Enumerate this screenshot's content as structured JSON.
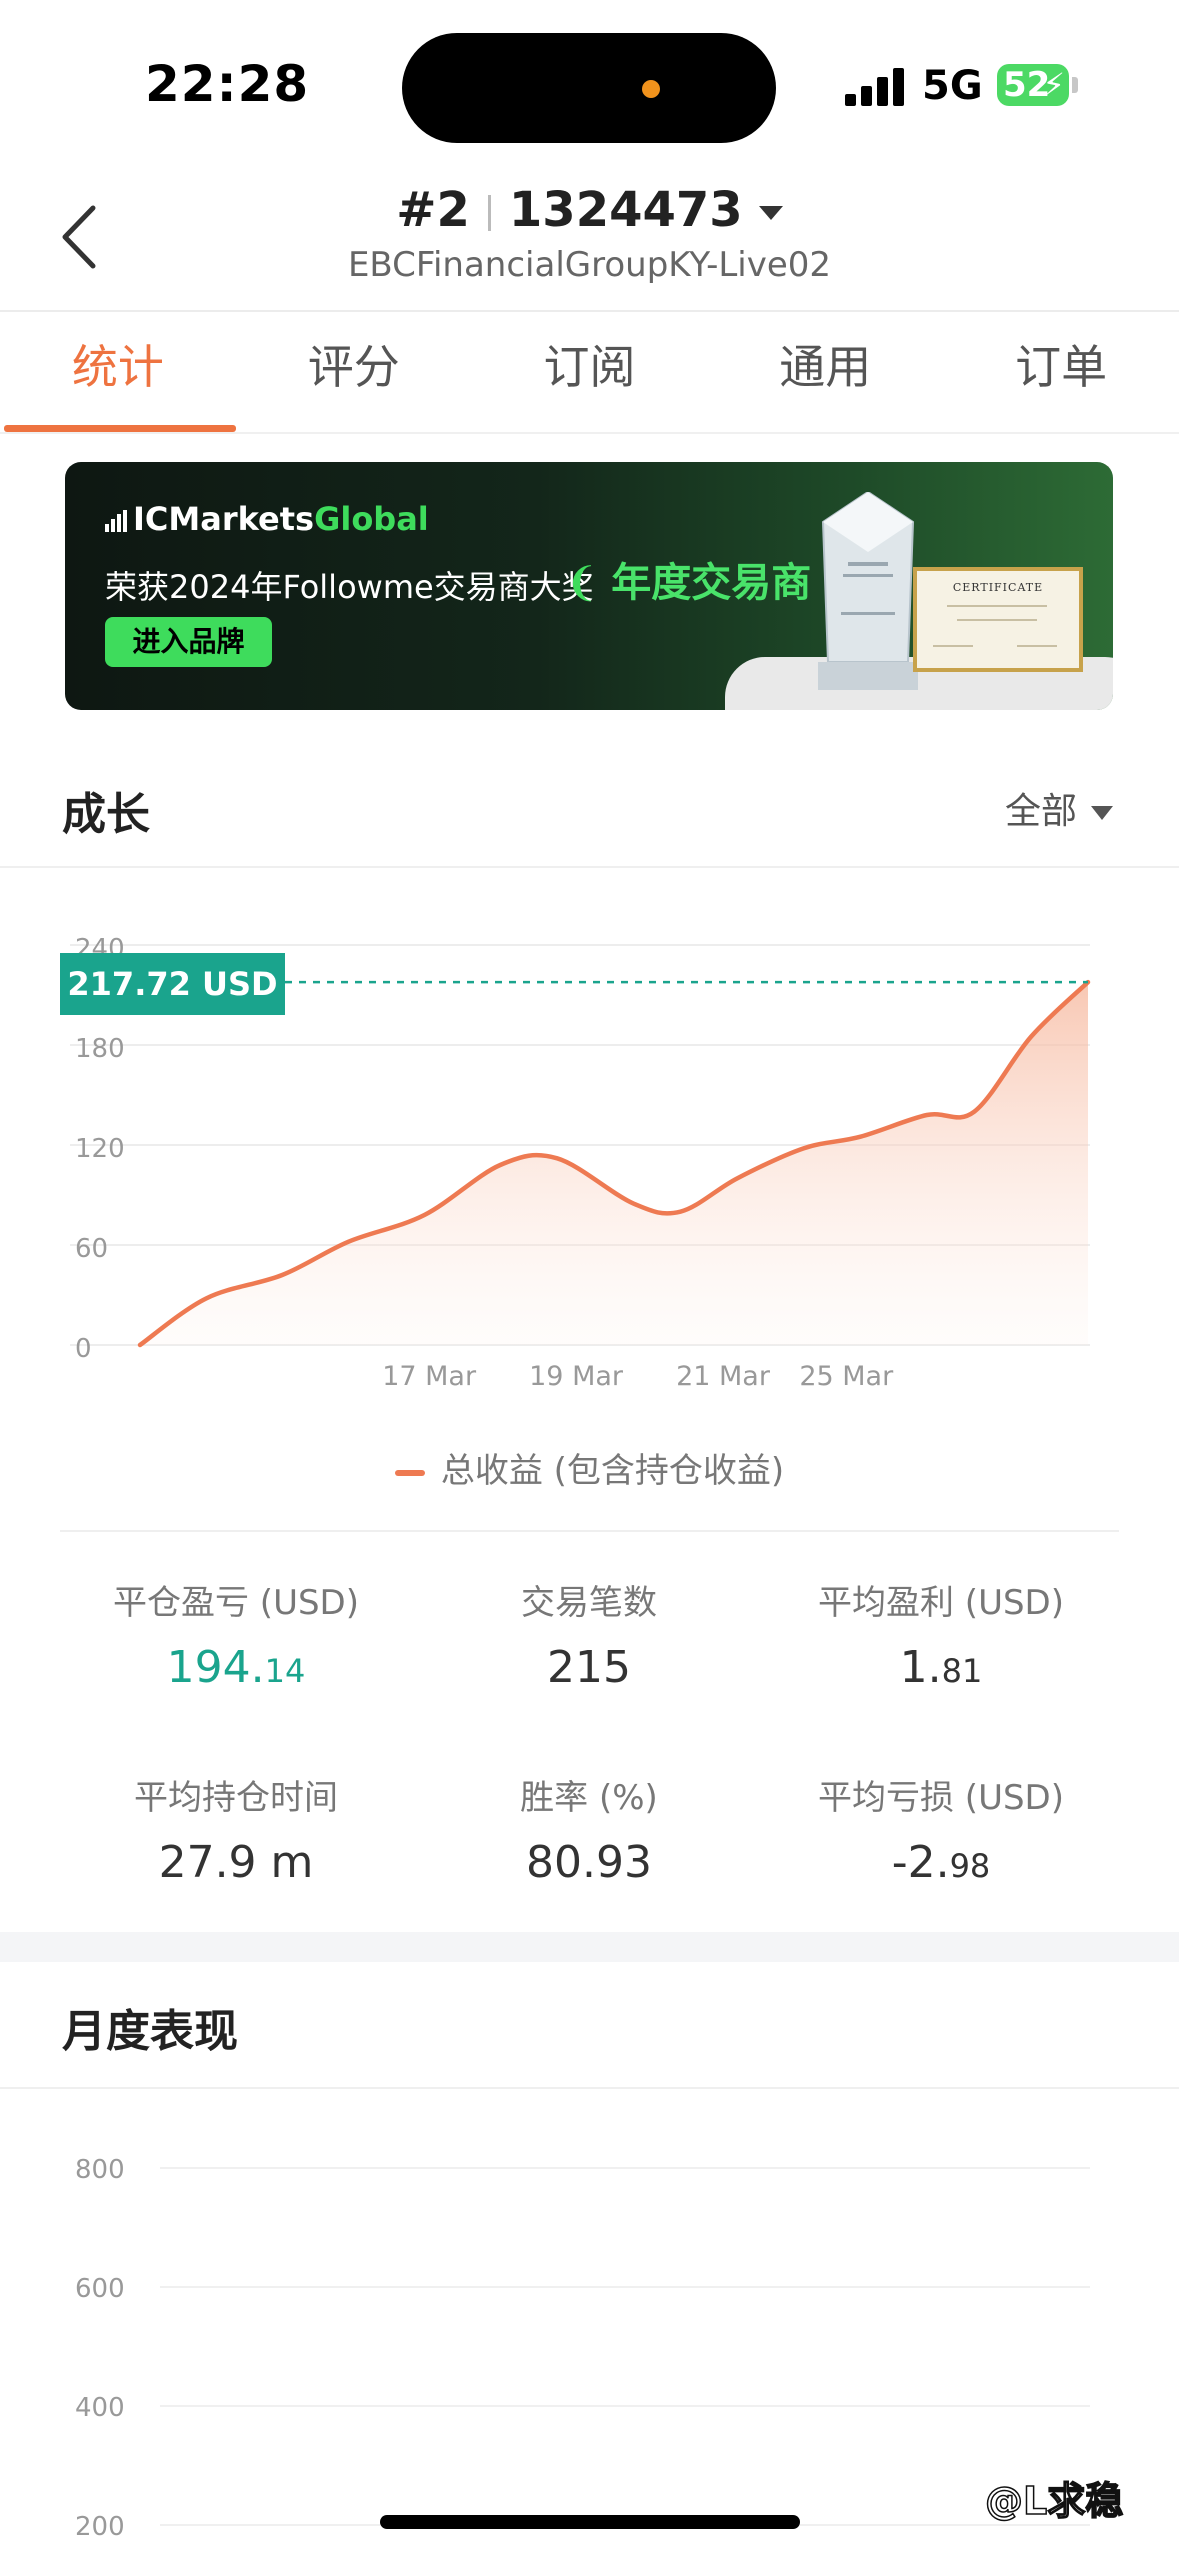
{
  "status_bar": {
    "time": "22:28",
    "network": "5G",
    "battery": "52"
  },
  "header": {
    "account_rank": "#2",
    "account_number": "1324473",
    "server": "EBCFinancialGroupKY-Live02"
  },
  "tabs": [
    {
      "label": "统计",
      "active": true
    },
    {
      "label": "评分",
      "active": false
    },
    {
      "label": "订阅",
      "active": false
    },
    {
      "label": "通用",
      "active": false
    },
    {
      "label": "订单",
      "active": false
    }
  ],
  "banner": {
    "logo_ic": "IC",
    "logo_markets": "Markets",
    "logo_global": "Global",
    "text": "荣获2024年Followme交易商大奖",
    "award": "年度交易商",
    "button": "进入品牌",
    "certificate_title": "CERTIFICATE"
  },
  "growth": {
    "title": "成长",
    "range": "全部",
    "current_value": "217.72 USD",
    "legend": "总收益 (包含持仓收益)"
  },
  "chart_data": [
    {
      "type": "area",
      "title": "",
      "xlabel": "",
      "ylabel": "",
      "ylim": [
        0,
        240
      ],
      "yticks": [
        0,
        60,
        120,
        180,
        240
      ],
      "xticks": [
        "17 Mar",
        "19 Mar",
        "21 Mar",
        "25 Mar"
      ],
      "grid": true,
      "series": [
        {
          "name": "总收益 (包含持仓收益)",
          "color": "#ee7a52",
          "points": [
            {
              "x": 0,
              "y": 0
            },
            {
              "x": 0.07,
              "y": 28
            },
            {
              "x": 0.15,
              "y": 42
            },
            {
              "x": 0.22,
              "y": 62
            },
            {
              "x": 0.3,
              "y": 78
            },
            {
              "x": 0.38,
              "y": 108
            },
            {
              "x": 0.44,
              "y": 112
            },
            {
              "x": 0.52,
              "y": 85
            },
            {
              "x": 0.57,
              "y": 80
            },
            {
              "x": 0.63,
              "y": 100
            },
            {
              "x": 0.7,
              "y": 118
            },
            {
              "x": 0.76,
              "y": 125
            },
            {
              "x": 0.83,
              "y": 138
            },
            {
              "x": 0.88,
              "y": 140
            },
            {
              "x": 0.94,
              "y": 185
            },
            {
              "x": 1.0,
              "y": 217.72
            }
          ]
        }
      ],
      "reference_line": {
        "value": 217.72,
        "color": "#1aa48d"
      }
    },
    {
      "type": "bar",
      "title": "月度表现",
      "ylim": [
        200,
        800
      ],
      "yticks": [
        200,
        400,
        600,
        800
      ],
      "categories": [],
      "values": []
    }
  ],
  "stats": [
    {
      "label": "平仓盈亏 (USD)",
      "value_int": "194.",
      "value_dec": "14",
      "color": "green"
    },
    {
      "label": "交易笔数",
      "value_int": "215",
      "value_dec": "",
      "color": "normal"
    },
    {
      "label": "平均盈利 (USD)",
      "value_int": "1.",
      "value_dec": "81",
      "color": "normal"
    },
    {
      "label": "平均持仓时间",
      "value_int": "27.9 m",
      "value_dec": "",
      "color": "normal"
    },
    {
      "label": "胜率 (%)",
      "value_int": "80.93",
      "value_dec": "",
      "color": "normal"
    },
    {
      "label": "平均亏损 (USD)",
      "value_int": "-2.",
      "value_dec": "98",
      "color": "normal"
    }
  ],
  "monthly": {
    "title": "月度表现"
  },
  "watermark": "@L求稳"
}
